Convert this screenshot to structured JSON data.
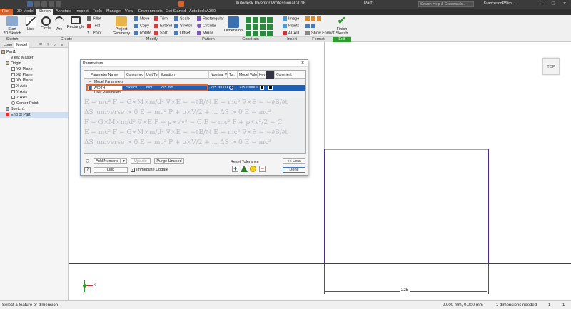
{
  "app": {
    "title": "Autodesk Inventor Professional 2018",
    "document": "Part1",
    "search_placeholder": "Search Help & Commands...",
    "user": "FrancescoPSim..."
  },
  "tabs": [
    "File",
    "3D Model",
    "Sketch",
    "Annotate",
    "Inspect",
    "Tools",
    "Manage",
    "View",
    "Environments",
    "Get Started",
    "Autodesk A360"
  ],
  "ribbon": {
    "start_sketch": "Start\n2D Sketch",
    "line": "Line",
    "circle": "Circle",
    "arc": "Arc",
    "rectangle": "Rectangle",
    "fillet": "Fillet",
    "text": "Text",
    "point": "Point",
    "project_geometry": "Project\nGeometry",
    "move": "Move",
    "copy": "Copy",
    "rotate": "Rotate",
    "trim": "Trim",
    "extend": "Extend",
    "split": "Split",
    "scale": "Scale",
    "stretch": "Stretch",
    "offset": "Offset",
    "rect_pattern": "Rectangular",
    "circular": "Circular",
    "mirror": "Mirror",
    "dimension": "Dimension",
    "image": "Image",
    "points": "Points",
    "acad": "ACAD",
    "show_format": "Show Format",
    "finish_sketch": "Finish\nSketch",
    "panels": [
      "Sketch",
      "Create",
      "Modify",
      "Pattern",
      "Constrain",
      "Insert",
      "Format",
      "Exit"
    ]
  },
  "browser": {
    "tabs": [
      "Logo",
      "Model"
    ],
    "items": [
      "Part1",
      "View: Master",
      "Origin",
      "YZ Plane",
      "XZ Plane",
      "XY Plane",
      "X Axis",
      "Y Axis",
      "Z Axis",
      "Center Point",
      "Sketch1",
      "End of Part"
    ]
  },
  "viewcube": "TOP",
  "canvas": {
    "dimension_value": "225",
    "triad_x": "X",
    "triad_z": "Z"
  },
  "dialog": {
    "title": "Parameters",
    "columns": [
      "Parameter Name",
      "Consumed b",
      "Unit/Typ",
      "Equation",
      "Nominal Valu",
      "Tol.",
      "Model Value",
      "Key",
      "",
      "Comment"
    ],
    "group_model": "Model Parameters",
    "group_user": "User Parameters",
    "row": {
      "name": "WIDTH",
      "consumed": "Sketch1",
      "unit": "mm",
      "equation": "225 mm",
      "nominal": "225.000000",
      "model_value": "225.000000"
    },
    "add_numeric": "Add Numeric",
    "update": "Update",
    "purge_unused": "Purge Unused",
    "link": "Link",
    "immediate_update": "Immediate Update",
    "reset_tolerance": "Reset Tolerance",
    "less": "<< Less",
    "done": "Done",
    "formulas": [
      "E = mc²   F = G×M×m/d²   ∇×E = −∂B/∂t   E = mc²   ∇×E = −∂B/∂t",
      "ΔS_universe > 0   E = mc²   P + ρ×V/2 + ...   ΔS > 0   E = mc²",
      "F = G×M×m/d²   ∇×E   P + ρ×√v² = C   E = mc²   P + ρ×v²/2 = C"
    ]
  },
  "status": {
    "left": "Select a feature or dimension",
    "coords": "0.000 mm, 0.000 mm",
    "dims": "1 dimensions needed",
    "n1": "1",
    "n2": "1"
  },
  "colors": {
    "accent_orange": "#d4622a",
    "sketch_purple": "#4b2a8a",
    "sketch_green": "#7ed321",
    "highlight_orange": "#e8622a",
    "selection_blue": "#1f5fb4"
  }
}
